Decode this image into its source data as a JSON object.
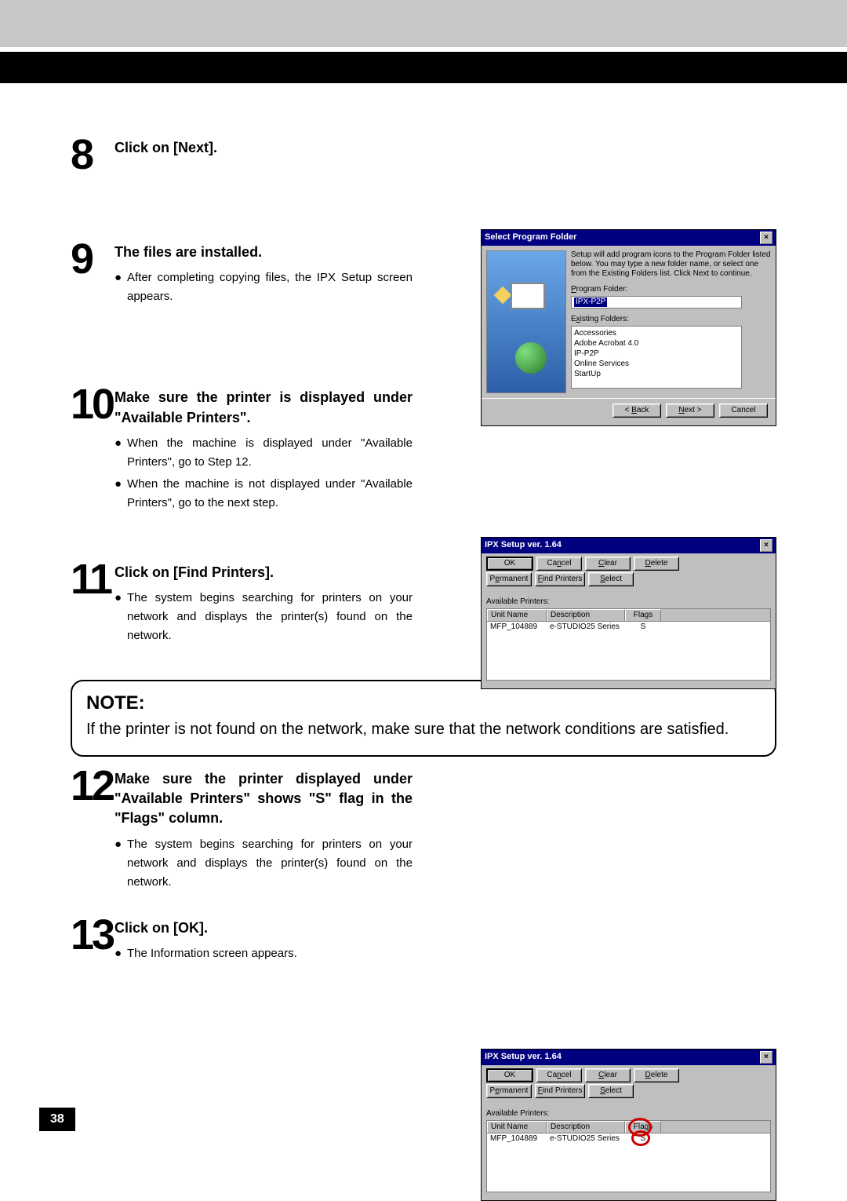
{
  "page_number": "38",
  "steps": [
    {
      "num": "8",
      "head": "Click on [Next]."
    },
    {
      "num": "9",
      "head": "The files are installed.",
      "bullets": [
        "After completing copying files, the IPX Setup screen appears."
      ]
    },
    {
      "num": "10",
      "head": "Make sure the printer is displayed under \"Available Printers\".",
      "bullets": [
        "When the machine is displayed under \"Available Printers\", go to Step 12.",
        "When the machine is not displayed under \"Available Printers\", go to the next step."
      ]
    },
    {
      "num": "11",
      "head": "Click on [Find Printers].",
      "bullets": [
        "The system begins searching for printers on your  network and displays the printer(s) found on the network."
      ]
    },
    {
      "num": "12",
      "head": "Make sure the printer displayed under \"Available Printers\" shows \"S\" flag in the \"Flags\" column.",
      "bullets": [
        "The system begins searching for printers on your  network and displays the printer(s) found on the network."
      ]
    },
    {
      "num": "13",
      "head": "Click on [OK].",
      "bullets": [
        "The Information screen appears."
      ]
    }
  ],
  "note": {
    "title": "NOTE:",
    "text": "If the printer is not found on the network, make sure that the network conditions are satisfied."
  },
  "dialog1": {
    "title": "Select Program Folder",
    "intro": "Setup will add program icons to the Program Folder listed below. You may type a new folder name, or select one from the Existing Folders list. Click Next to continue.",
    "program_label": "Program Folder:",
    "program_value": "IPX-P2P",
    "existing_label": "Existing Folders:",
    "existing": [
      "Accessories",
      "Adobe Acrobat 4.0",
      "IP-P2P",
      "Online Services",
      "StartUp"
    ],
    "buttons": {
      "back": "< Back",
      "next": "Next >",
      "cancel": "Cancel"
    }
  },
  "dialog2": {
    "title": "IPX Setup ver. 1.64",
    "buttons": {
      "ok": "OK",
      "cancel": "Cancel",
      "clear": "Clear",
      "delete": "Delete",
      "permanent": "Permanent",
      "find": "Find Printers",
      "select": "Select"
    },
    "label": "Available Printers:",
    "cols": {
      "c1": "Unit Name",
      "c2": "Description",
      "c3": "Flags"
    },
    "row": {
      "c1": "MFP_104889",
      "c2": "e-STUDIO25 Series",
      "c3": "S"
    }
  }
}
